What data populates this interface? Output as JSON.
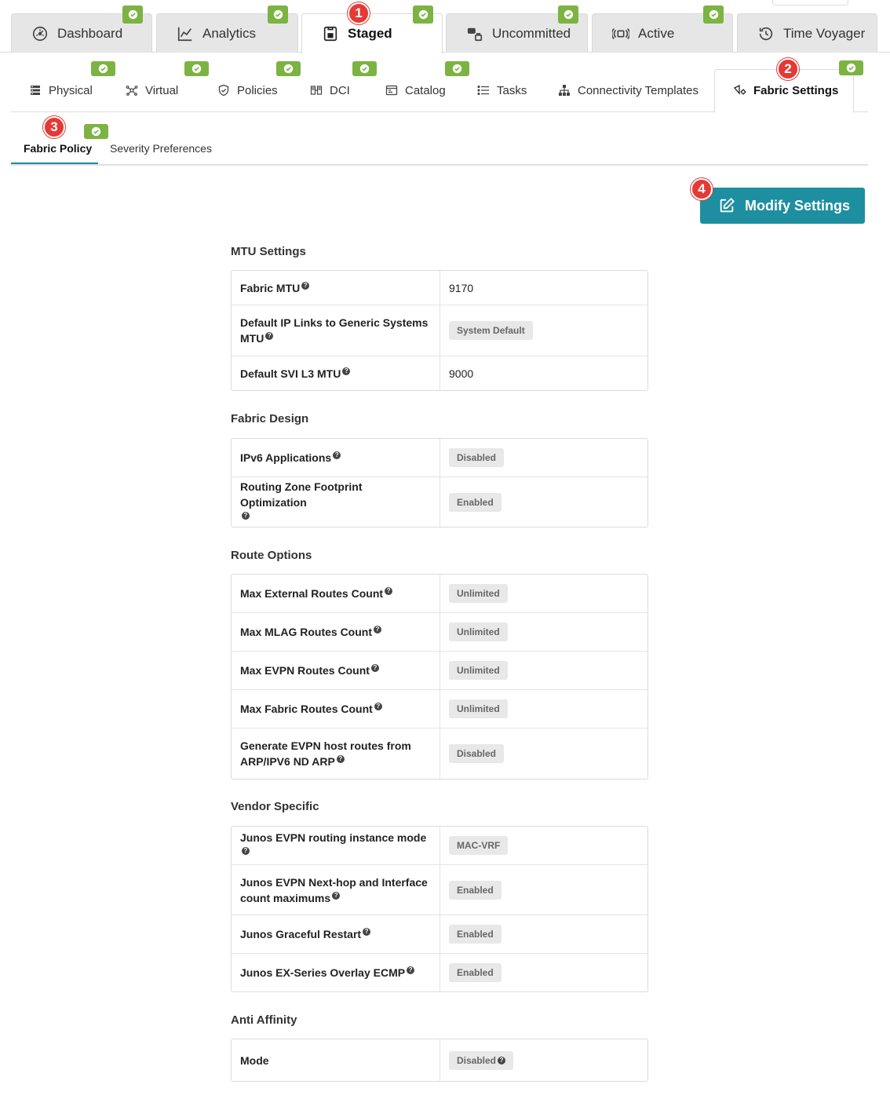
{
  "top_tabs": [
    {
      "label": "Dashboard",
      "icon": "dashboard-gauge-icon"
    },
    {
      "label": "Analytics",
      "icon": "line-chart-icon"
    },
    {
      "label": "Staged",
      "icon": "staged-doc-icon"
    },
    {
      "label": "Uncommitted",
      "icon": "uncommitted-icon"
    },
    {
      "label": "Active",
      "icon": "active-signal-icon"
    },
    {
      "label": "Time Voyager",
      "icon": "history-icon"
    }
  ],
  "sub_tabs": [
    {
      "label": "Physical",
      "icon": "physical-rack-icon"
    },
    {
      "label": "Virtual",
      "icon": "virtual-network-icon"
    },
    {
      "label": "Policies",
      "icon": "shield-icon"
    },
    {
      "label": "DCI",
      "icon": "dci-icon"
    },
    {
      "label": "Catalog",
      "icon": "catalog-icon"
    },
    {
      "label": "Tasks",
      "icon": "list-icon"
    },
    {
      "label": "Connectivity Templates",
      "icon": "hierarchy-icon"
    },
    {
      "label": "Fabric Settings",
      "icon": "fabric-settings-icon"
    }
  ],
  "l3_tabs": [
    {
      "label": "Fabric Policy"
    },
    {
      "label": "Severity Preferences"
    }
  ],
  "badges": [
    "1",
    "2",
    "3",
    "4"
  ],
  "modify_button": {
    "label": "Modify Settings"
  },
  "help_glyph": "?",
  "sections": {
    "mtu": {
      "title": "MTU Settings",
      "rows": [
        {
          "key": "Fabric MTU",
          "value": "9170"
        },
        {
          "key": "Default IP Links to Generic Systems MTU",
          "value": "System Default"
        },
        {
          "key": "Default SVI L3 MTU",
          "value": "9000"
        }
      ]
    },
    "design": {
      "title": "Fabric Design",
      "rows": [
        {
          "key": "IPv6 Applications",
          "value": "Disabled"
        },
        {
          "key": "Routing Zone Footprint Optimization",
          "value": "Enabled"
        }
      ]
    },
    "routes": {
      "title": "Route Options",
      "rows": [
        {
          "key": "Max External Routes Count",
          "value": "Unlimited"
        },
        {
          "key": "Max MLAG Routes Count",
          "value": "Unlimited"
        },
        {
          "key": "Max EVPN Routes Count",
          "value": "Unlimited"
        },
        {
          "key": "Max Fabric Routes Count",
          "value": "Unlimited"
        },
        {
          "key": "Generate EVPN host routes from ARP/IPV6 ND ARP",
          "value": "Disabled"
        }
      ]
    },
    "vendor": {
      "title": "Vendor Specific",
      "rows": [
        {
          "key": "Junos EVPN routing instance mode",
          "value": "MAC-VRF"
        },
        {
          "key": "Junos EVPN Next-hop and Interface count maximums",
          "value": "Enabled"
        },
        {
          "key": "Junos Graceful Restart",
          "value": "Enabled"
        },
        {
          "key": "Junos EX-Series Overlay ECMP",
          "value": "Enabled"
        }
      ]
    },
    "anti": {
      "title": "Anti Affinity",
      "rows": [
        {
          "key": "Mode",
          "value": "Disabled"
        }
      ]
    }
  },
  "colors": {
    "accent": "#1e8fa0",
    "check_green": "#7cb342",
    "badge_red": "#e53935",
    "tab_inactive_bg": "#e6e6e6"
  }
}
